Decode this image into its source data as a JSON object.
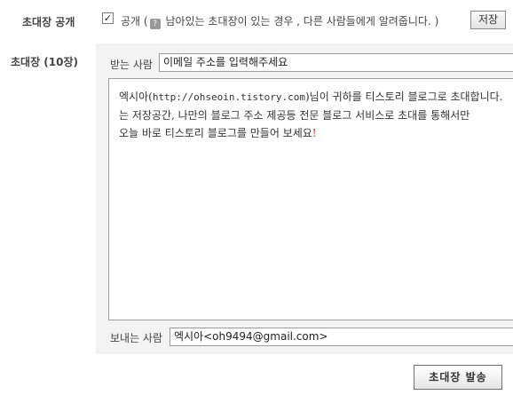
{
  "open_section": {
    "label": "초대장 공개",
    "checked_mark": "✓",
    "checkbox_label": "공개",
    "paren_open": "(",
    "help_glyph": "?",
    "note": "남아있는 초대장이 있는 경우 , 다른 사람들에게 알려줍니다.",
    "paren_close": ")",
    "save_label": "저장"
  },
  "invite": {
    "label": "초대장 (10장)",
    "to_label": "받는 사람",
    "to_placeholder": "이메일 주소를 입력해주세요",
    "message": {
      "line1_a": "엑시아(",
      "line1_url": "http://ohseoin.tistory.com",
      "line1_b": ")님이 귀하를 티스토리 블로그로 초대합니다.",
      "line2": "는 저장공간, 나만의 블로그 주소 제공등 전문 블로그 서비스로 초대를 통해서만",
      "line3_a": "오늘 바로 티스토리 블로그를 만들어 보세요",
      "line3_excl": "!"
    },
    "from_label": "보내는 사람",
    "from_value": "엑시아<oh9494@gmail.com>",
    "send_label": "초대장 발송"
  }
}
